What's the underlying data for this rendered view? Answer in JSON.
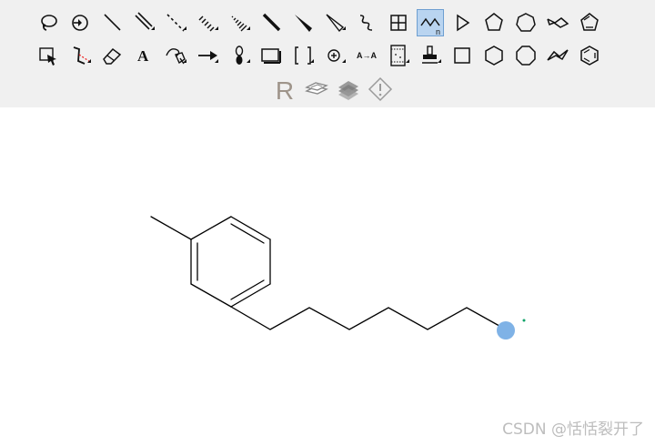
{
  "toolbar": {
    "active_tool": "chain-tool",
    "rows": [
      [
        "lasso-select-tool",
        "rotate-tool",
        "single-bond-tool",
        "double-bond-tool",
        "dashed-bond-tool",
        "hashed-bond-tool",
        "hashed-wedge-bond-tool",
        "bold-bond-tool",
        "wedge-bond-tool",
        "hollow-wedge-bond-tool",
        "wavy-bond-tool",
        "table-tool",
        "chain-tool",
        "cyclopropane-tool",
        "cyclopentane-tool",
        "cycloheptane-tool",
        "cyclohexane-chair-tool",
        "cyclopentadiene-tool"
      ],
      [
        "marquee-select-tool",
        "bond-angle-tool",
        "eraser-tool",
        "text-tool",
        "pen-tool",
        "arrow-tool",
        "orbital-tool",
        "rectangle-tool",
        "bracket-tool",
        "charge-tool",
        "atom-map-tool",
        "tlc-plate-tool",
        "template-stamp-tool",
        "cyclobutane-tool",
        "cyclohexane-tool",
        "cyclooctane-tool",
        "cyclohexane-chair-alt-tool",
        "benzene-tool"
      ],
      [
        "r-group-tool",
        "query-tool",
        "textured-surface-tool",
        "alert-tool"
      ]
    ],
    "text_glyphs": {
      "text_tool": "A",
      "atom_map_tool": "A→A",
      "r_group_tool": "R"
    }
  },
  "canvas": {
    "molecule": "1-heptyl-3-methylbenzene",
    "selection_color": "#4a90e2",
    "watermark": "CSDN @恬恬裂开了"
  }
}
